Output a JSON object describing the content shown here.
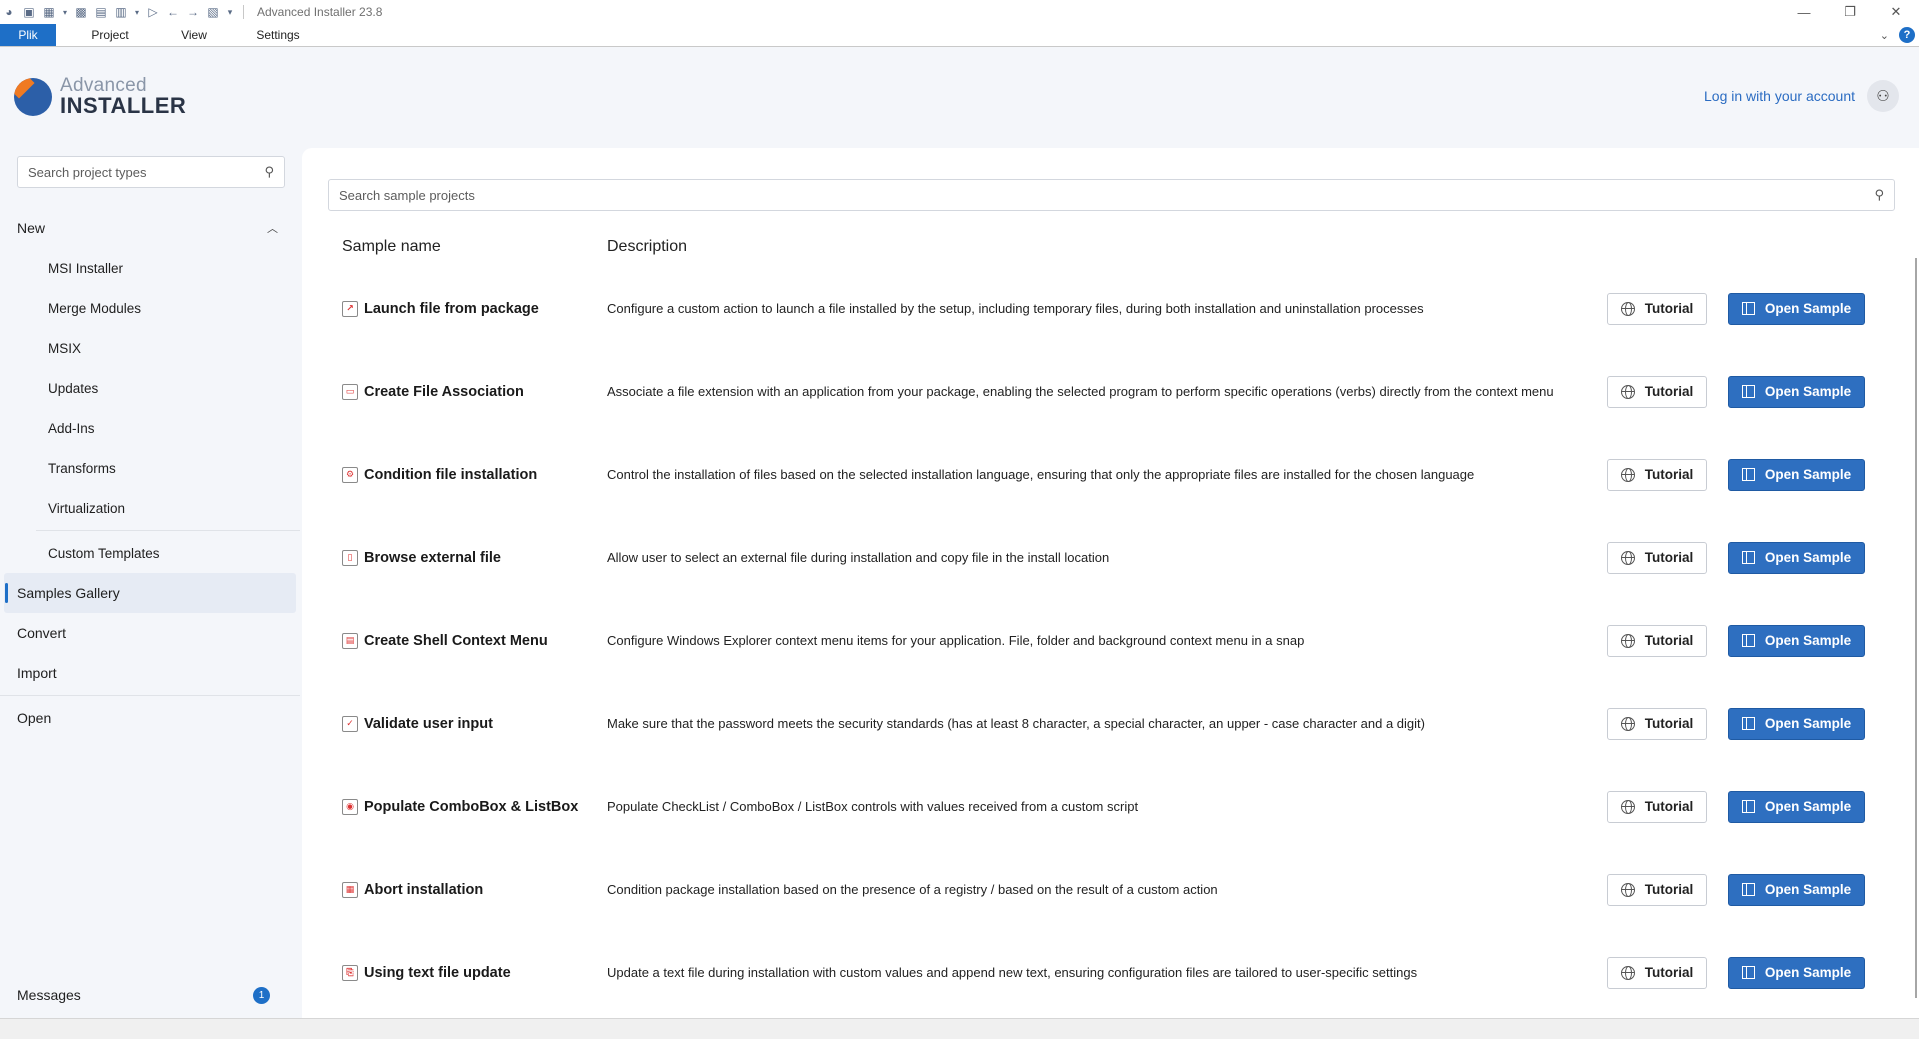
{
  "window": {
    "title": "Advanced Installer 23.8"
  },
  "ribbon": {
    "tabs": [
      "Plik",
      "Project",
      "View",
      "Settings"
    ]
  },
  "header": {
    "logo_line1": "Advanced",
    "logo_line2": "INSTALLER",
    "login_label": "Log in with your account"
  },
  "sidebar": {
    "search_placeholder": "Search project types",
    "new_label": "New",
    "new_items": [
      "MSI Installer",
      "Merge Modules",
      "MSIX",
      "Updates",
      "Add-Ins",
      "Transforms",
      "Virtualization"
    ],
    "custom_templates": "Custom Templates",
    "samples_gallery": "Samples Gallery",
    "convert": "Convert",
    "import": "Import",
    "open": "Open",
    "messages_label": "Messages",
    "messages_count": "1"
  },
  "main": {
    "search_placeholder": "Search sample projects",
    "col_name": "Sample name",
    "col_desc": "Description",
    "tutorial_label": "Tutorial",
    "open_label": "Open Sample",
    "samples": [
      {
        "name": "Launch file from package",
        "desc": "Configure a custom action to launch a file installed by the setup, including temporary files, during both installation and uninstallation processes",
        "icon": "launch-file-icon"
      },
      {
        "name": "Create File Association",
        "desc": "Associate a file extension with an application from your package, enabling the selected program to perform specific operations (verbs) directly from the context menu",
        "icon": "file-association-icon"
      },
      {
        "name": "Condition file installation",
        "desc": "Control the installation of files based on the selected installation language, ensuring that only the appropriate files are installed for the chosen language",
        "icon": "condition-icon"
      },
      {
        "name": "Browse external file",
        "desc": "Allow user to select an external file during installation and copy file in the install location",
        "icon": "browse-file-icon"
      },
      {
        "name": "Create Shell Context Menu",
        "desc": "Configure Windows Explorer context menu items for your application. File, folder and background context menu in a snap",
        "icon": "context-menu-icon"
      },
      {
        "name": "Validate user input",
        "desc": "Make sure that the password meets the security standards (has at least 8 character, a special character, an upper - case character and a digit)",
        "icon": "validate-icon"
      },
      {
        "name": "Populate ComboBox & ListBox",
        "desc": "Populate CheckList / ComboBox / ListBox controls with values received from a custom script",
        "icon": "combobox-icon"
      },
      {
        "name": "Abort installation",
        "desc": "Condition package installation based on the presence of a registry / based on the result of a custom action",
        "icon": "abort-icon"
      },
      {
        "name": "Using text file update",
        "desc": "Update a text file during installation with custom values and append new text, ensuring configuration files are tailored to user-specific settings",
        "icon": "text-update-icon"
      }
    ]
  }
}
